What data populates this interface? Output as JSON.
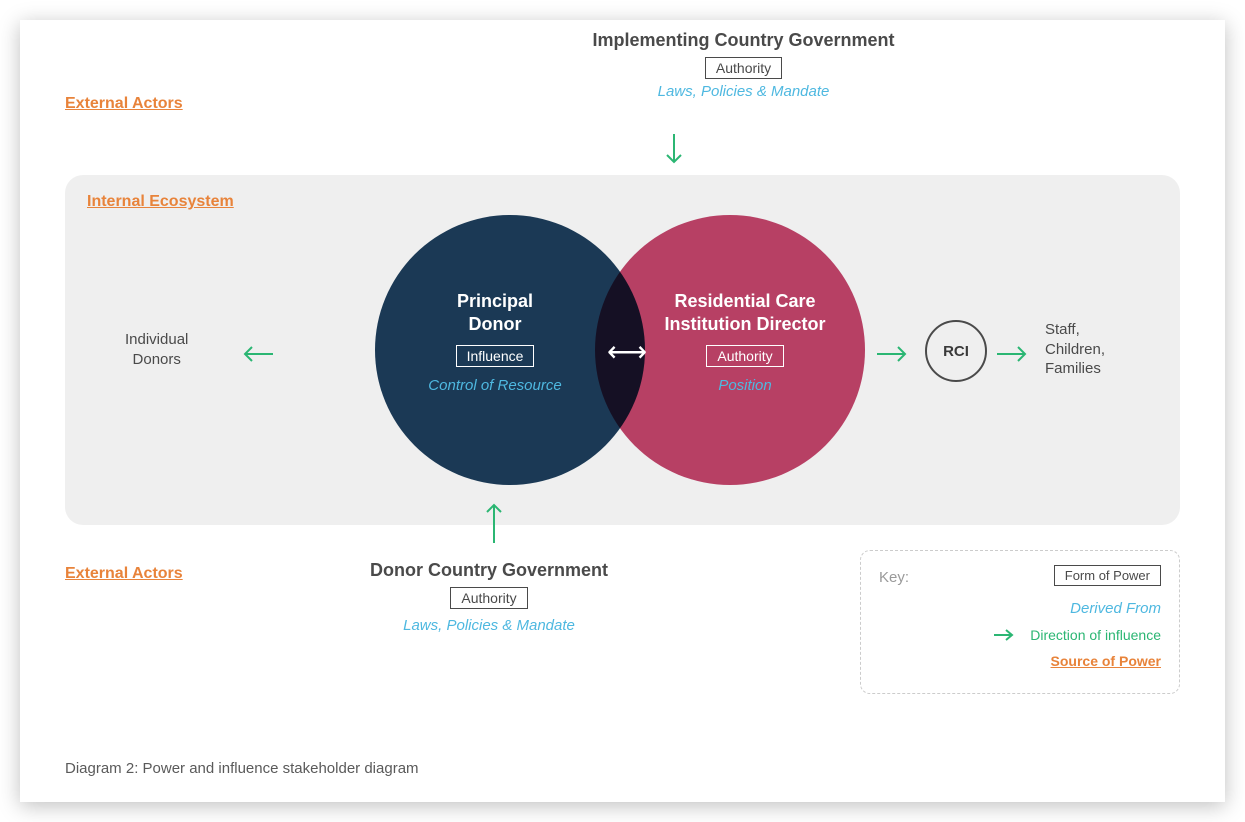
{
  "labels": {
    "external_actors": "External Actors",
    "internal_ecosystem": "Internal Ecosystem"
  },
  "top_actor": {
    "title": "Implementing Country Government",
    "power": "Authority",
    "derived": "Laws, Policies & Mandate"
  },
  "left_circle": {
    "title_line1": "Principal",
    "title_line2": "Donor",
    "power": "Influence",
    "derived": "Control of Resource"
  },
  "right_circle": {
    "title_line1": "Residential Care",
    "title_line2": "Institution Director",
    "power": "Authority",
    "derived": "Position"
  },
  "left_text": "Individual\nDonors",
  "rci": "RCI",
  "right_text": "Staff,\nChildren,\nFamilies",
  "bottom_actor": {
    "title": "Donor Country Government",
    "power": "Authority",
    "derived": "Laws, Policies & Mandate"
  },
  "key": {
    "label": "Key:",
    "form": "Form of Power",
    "derived": "Derived From",
    "direction": "Direction of influence",
    "source": "Source of Power"
  },
  "caption": "Diagram 2: Power and influence stakeholder diagram"
}
